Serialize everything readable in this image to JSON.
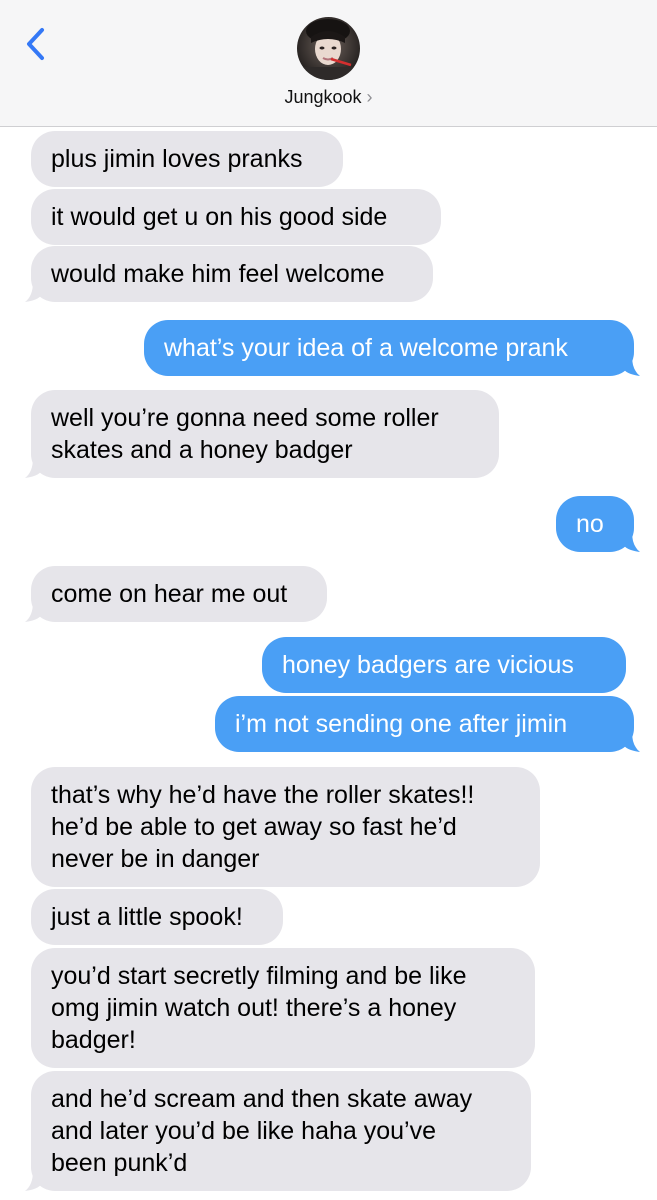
{
  "header": {
    "back_icon": "chevron-left-icon",
    "contact_name": "Jungkook",
    "contact_chevron": "›",
    "accent": "#3478f6",
    "background": "#f6f6f7"
  },
  "colors": {
    "incoming_bubble": "#e6e5ea",
    "outgoing_bubble": "#4a9ff5"
  },
  "messages": [
    {
      "direction": "incoming",
      "lines": [
        "plus jimin loves pranks"
      ]
    },
    {
      "direction": "incoming",
      "lines": [
        "it would get u on his good side"
      ]
    },
    {
      "direction": "incoming",
      "lines": [
        "would make him feel welcome"
      ]
    },
    {
      "direction": "outgoing",
      "lines": [
        "what’s your idea of a welcome prank"
      ]
    },
    {
      "direction": "incoming",
      "lines": [
        "well you’re gonna need some roller",
        "skates and a honey badger"
      ]
    },
    {
      "direction": "outgoing",
      "lines": [
        "no"
      ]
    },
    {
      "direction": "incoming",
      "lines": [
        "come on hear me out"
      ]
    },
    {
      "direction": "outgoing",
      "lines": [
        "honey badgers are vicious"
      ]
    },
    {
      "direction": "outgoing",
      "lines": [
        "i’m not sending one after jimin"
      ]
    },
    {
      "direction": "incoming",
      "lines": [
        "that’s why he’d have the roller skates!!",
        "he’d be able to get away so fast he’d",
        "never be in danger"
      ]
    },
    {
      "direction": "incoming",
      "lines": [
        "just a little spook!"
      ]
    },
    {
      "direction": "incoming",
      "lines": [
        "you’d start secretly filming and be like",
        "omg jimin watch out! there’s a honey",
        "badger!"
      ]
    },
    {
      "direction": "incoming",
      "lines": [
        "and he’d scream and then skate away",
        "and later you’d be like haha you’ve",
        "been punk’d"
      ]
    }
  ]
}
